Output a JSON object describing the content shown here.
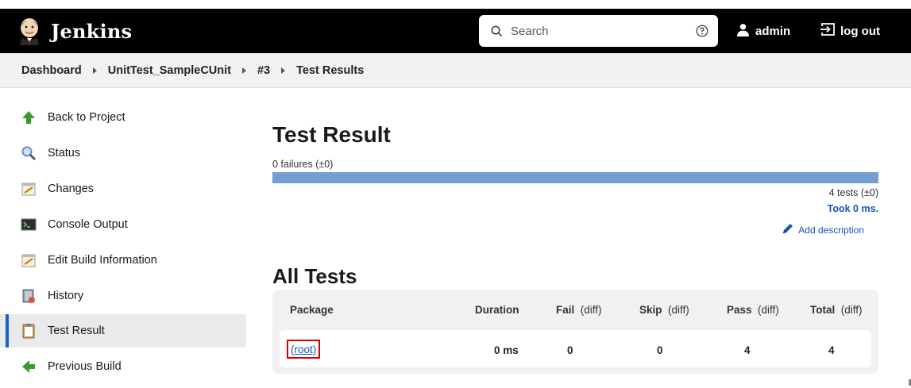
{
  "header": {
    "brand": "Jenkins",
    "search": {
      "placeholder": "Search"
    },
    "user": "admin",
    "logout": "log out"
  },
  "breadcrumb": [
    "Dashboard",
    "UnitTest_SampleCUnit",
    "#3",
    "Test Results"
  ],
  "sidebar": {
    "items": [
      {
        "label": "Back to Project",
        "icon": "up-arrow-icon"
      },
      {
        "label": "Status",
        "icon": "magnifier-icon"
      },
      {
        "label": "Changes",
        "icon": "notepad-icon"
      },
      {
        "label": "Console Output",
        "icon": "terminal-icon"
      },
      {
        "label": "Edit Build Information",
        "icon": "notepad-icon"
      },
      {
        "label": "History",
        "icon": "history-icon"
      },
      {
        "label": "Test Result",
        "icon": "clipboard-icon",
        "active": true
      },
      {
        "label": "Previous Build",
        "icon": "left-arrow-icon"
      }
    ]
  },
  "main": {
    "title": "Test Result",
    "failures": "0 failures (±0)",
    "tests_count": "4 tests (±0)",
    "took": "Took 0 ms.",
    "add_description": "Add description",
    "all_tests_title": "All Tests",
    "pass_fraction": 1.0,
    "table": {
      "headers": {
        "package": "Package",
        "duration": "Duration",
        "fail": "Fail",
        "skip": "Skip",
        "pass": "Pass",
        "total": "Total",
        "diff": "(diff)"
      },
      "rows": [
        {
          "package": "(root)",
          "duration": "0 ms",
          "fail": "0",
          "skip": "0",
          "pass": "4",
          "total": "4"
        }
      ]
    }
  },
  "colors": {
    "header_bg": "#000000",
    "link": "#1457b4",
    "pass_bar": "#729fcf",
    "highlight": "#d40000",
    "active_indicator": "#0f62c7"
  }
}
